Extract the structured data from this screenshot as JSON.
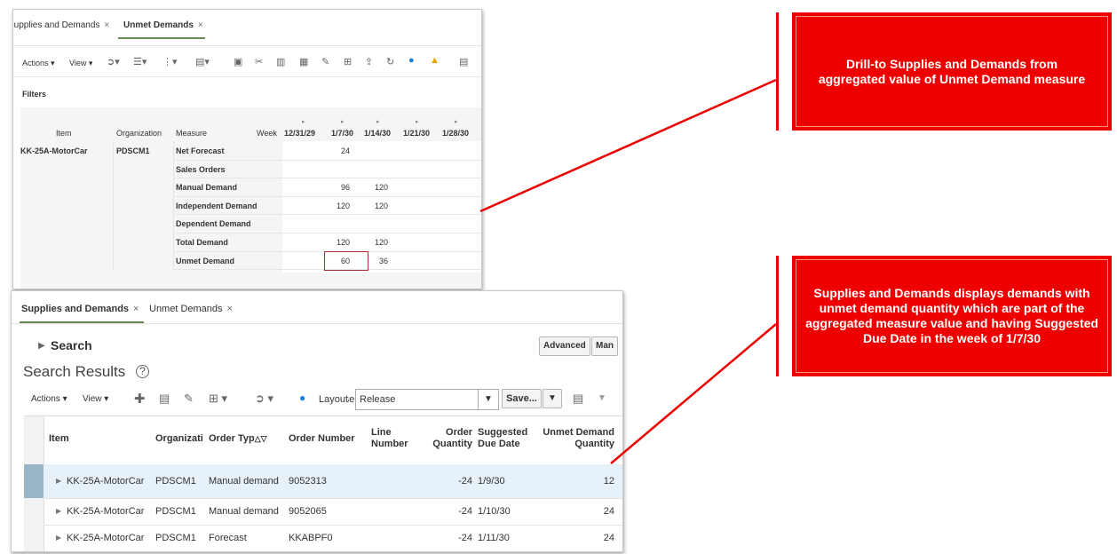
{
  "top_panel": {
    "tabs": [
      {
        "label": "Supplies and Demands",
        "close": "×"
      },
      {
        "label": "Unmet Demands",
        "close": "×"
      }
    ],
    "toolbar": {
      "actions": "Actions",
      "view": "View"
    },
    "filters_label": "Filters",
    "columns": {
      "item": "Item",
      "organization": "Organization",
      "measure": "Measure",
      "week": "Week"
    },
    "weeks": [
      "12/31/29",
      "1/7/30",
      "1/14/30",
      "1/21/30",
      "1/28/30"
    ],
    "item": "KK-25A-MotorCar",
    "organization": "PDSCM1",
    "rows": [
      {
        "measure": "Net Forecast",
        "values": [
          "",
          "24",
          "",
          "",
          ""
        ]
      },
      {
        "measure": "Sales Orders",
        "values": [
          "",
          "",
          "",
          "",
          ""
        ]
      },
      {
        "measure": "Manual Demand",
        "values": [
          "",
          "96",
          "120",
          "",
          ""
        ]
      },
      {
        "measure": "Independent Demand",
        "values": [
          "",
          "120",
          "120",
          "",
          ""
        ]
      },
      {
        "measure": "Dependent Demand",
        "values": [
          "",
          "",
          "",
          "",
          ""
        ]
      },
      {
        "measure": "Total Demand",
        "values": [
          "",
          "120",
          "120",
          "",
          ""
        ]
      },
      {
        "measure": "Unmet Demand",
        "values": [
          "",
          "60",
          "36",
          "",
          ""
        ]
      }
    ]
  },
  "bottom_panel": {
    "tabs": [
      {
        "label": "Supplies and Demands",
        "close": "×"
      },
      {
        "label": "Unmet Demands",
        "close": "×"
      }
    ],
    "search_label": "Search",
    "advanced_button": "Advanced",
    "manage_button": "Man",
    "results_title": "Search Results",
    "toolbar": {
      "actions": "Actions",
      "view": "View",
      "layout_label": "Layout",
      "layout_value": "Release",
      "save_button": "Save..."
    },
    "columns": {
      "item": "Item",
      "organization": "Organizati",
      "order_type": "Order Typ",
      "order_number": "Order Number",
      "line_number": "Line Number",
      "order_quantity": "Order Quantity",
      "suggested_due_date": "Suggested Due Date",
      "unmet_demand_quantity": "Unmet Demand Quantity"
    },
    "rows": [
      {
        "item": "KK-25A-MotorCar",
        "org": "PDSCM1",
        "order_type": "Manual demand",
        "order_number": "9052313",
        "line_number": "",
        "order_quantity": "-24",
        "due_date": "1/9/30",
        "unmet_qty": "12"
      },
      {
        "item": "KK-25A-MotorCar",
        "org": "PDSCM1",
        "order_type": "Manual demand",
        "order_number": "9052065",
        "line_number": "",
        "order_quantity": "-24",
        "due_date": "1/10/30",
        "unmet_qty": "24"
      },
      {
        "item": "KK-25A-MotorCar",
        "org": "PDSCM1",
        "order_type": "Forecast",
        "order_number": "KKABPF0",
        "line_number": "",
        "order_quantity": "-24",
        "due_date": "1/11/30",
        "unmet_qty": "24"
      }
    ]
  },
  "callouts": [
    {
      "text": "Drill-to Supplies and Demands from aggregated value of Unmet Demand measure"
    },
    {
      "text": "Supplies and Demands displays demands with unmet demand quantity which are part of the aggregated measure value and having Suggested Due Date in the week of 1/7/30"
    }
  ],
  "colors": {
    "callout": "#ee0000",
    "tab_underline": "#6a8a55",
    "selected_row": "#e6f1fa",
    "highlight_box": "#a33"
  }
}
